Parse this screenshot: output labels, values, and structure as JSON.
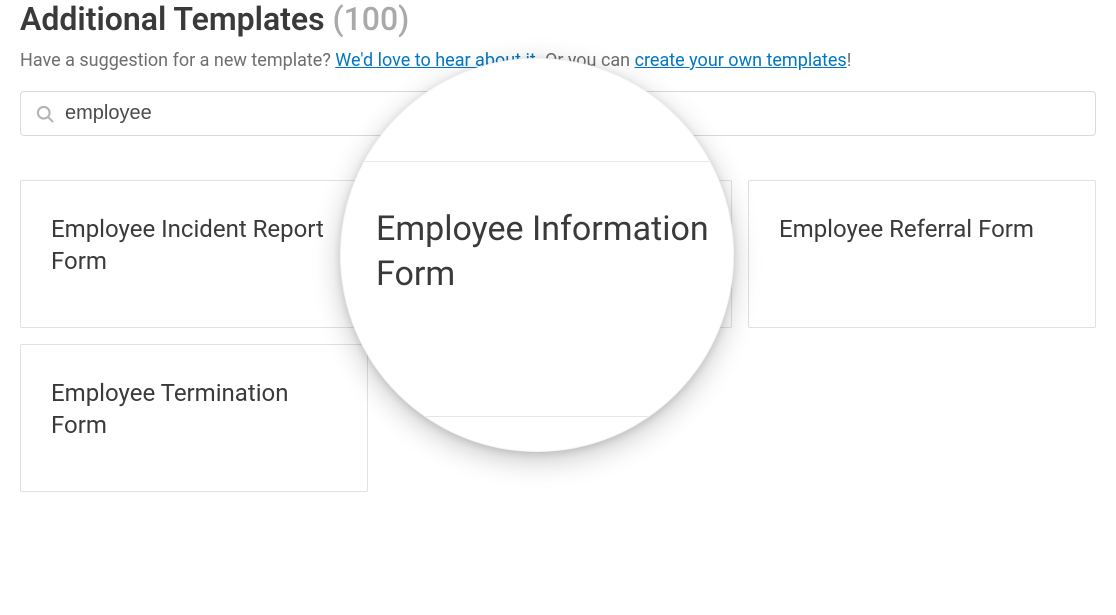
{
  "header": {
    "title": "Additional Templates",
    "count": "(100)"
  },
  "suggestion": {
    "prefix": "Have a suggestion for a new template? ",
    "link1": "We'd love to hear about it",
    "middle": ". Or you can ",
    "link2": "create your own templates",
    "suffix": "!"
  },
  "search": {
    "value": "employee",
    "placeholder": ""
  },
  "templates": [
    {
      "label": "Employee Incident Report Form"
    },
    {
      "label": "Employee Information Form"
    },
    {
      "label": "Employee Referral Form"
    },
    {
      "label": "Employee Termination Form"
    }
  ],
  "magnifier": {
    "highlighted_template": "Employee Information Form"
  }
}
